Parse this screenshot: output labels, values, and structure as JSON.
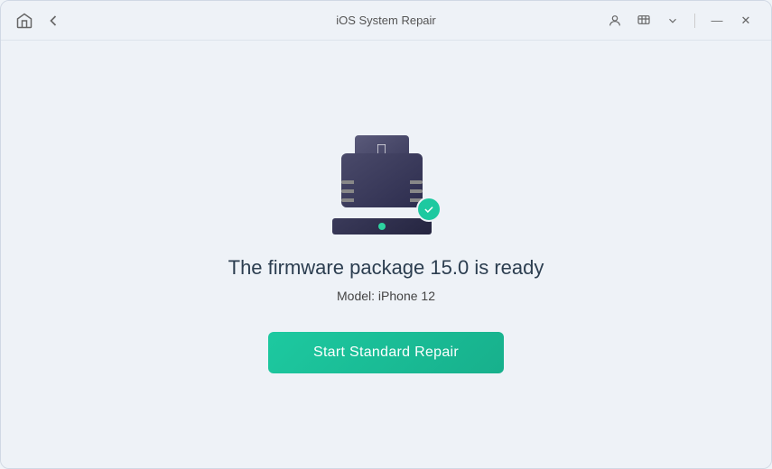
{
  "window": {
    "title": "iOS System Repair"
  },
  "titlebar": {
    "home_icon": "home",
    "back_icon": "back",
    "user_icon": "user",
    "chat_icon": "chat",
    "chevron_icon": "chevron-down",
    "minimize_label": "—",
    "close_label": "✕"
  },
  "content": {
    "firmware_status": "The firmware package 15.0 is ready",
    "firmware_version": "15.0",
    "model_label": "Model:",
    "model_value": "iPhone 12",
    "start_button_label": "Start Standard Repair"
  }
}
